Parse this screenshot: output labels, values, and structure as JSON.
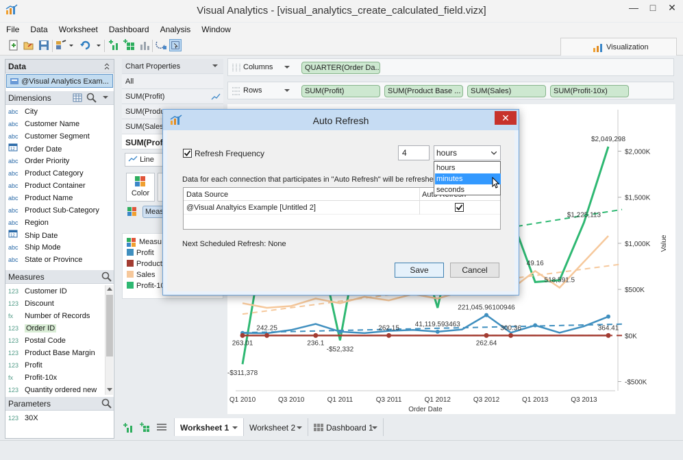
{
  "window": {
    "title": "Visual Analytics - [visual_analytics_create_calculated_field.vizx]",
    "minimize": "—",
    "maximize": "□",
    "close": "✕"
  },
  "menu": [
    "File",
    "Data",
    "Worksheet",
    "Dashboard",
    "Analysis",
    "Window"
  ],
  "toolbar": {
    "icons": [
      "new-icon",
      "open-icon",
      "save-icon",
      "paint-icon",
      "refresh-icon",
      "add-sheet-icon",
      "add-dashboard-icon",
      "bar-chart-icon",
      "lasso-icon",
      "pointer-icon"
    ]
  },
  "visualization_tab": {
    "label": "Visualization"
  },
  "data_panel": {
    "header": "Data",
    "datasource": "@Visual Analytics Exam...",
    "dimensions_label": "Dimensions",
    "dimensions": [
      {
        "type": "abc",
        "name": "City"
      },
      {
        "type": "abc",
        "name": "Customer Name"
      },
      {
        "type": "abc",
        "name": "Customer Segment"
      },
      {
        "type": "date",
        "name": "Order Date"
      },
      {
        "type": "abc",
        "name": "Order Priority"
      },
      {
        "type": "abc",
        "name": "Product Category"
      },
      {
        "type": "abc",
        "name": "Product Container"
      },
      {
        "type": "abc",
        "name": "Product Name"
      },
      {
        "type": "abc",
        "name": "Product Sub-Category"
      },
      {
        "type": "abc",
        "name": "Region"
      },
      {
        "type": "date",
        "name": "Ship Date"
      },
      {
        "type": "abc",
        "name": "Ship Mode"
      },
      {
        "type": "abc",
        "name": "State or Province"
      }
    ],
    "measures_label": "Measures",
    "measures": [
      {
        "type": "123",
        "name": "Customer ID"
      },
      {
        "type": "123",
        "name": "Discount"
      },
      {
        "type": "fx",
        "name": "Number of Records"
      },
      {
        "type": "123",
        "name": "Order ID"
      },
      {
        "type": "123",
        "name": "Postal Code"
      },
      {
        "type": "123",
        "name": "Product Base Margin"
      },
      {
        "type": "123",
        "name": "Profit"
      },
      {
        "type": "fx",
        "name": "Profit-10x"
      },
      {
        "type": "123",
        "name": "Quantity ordered new"
      }
    ],
    "parameters_label": "Parameters",
    "parameters": [
      {
        "type": "123",
        "name": "30X"
      }
    ]
  },
  "chart_properties": {
    "header": "Chart Properties",
    "rows": [
      "All",
      "SUM(Profit)",
      "SUM(Produ",
      "SUM(Sales)",
      "SUM(Profi"
    ],
    "mark_type": "Line",
    "color_label": "Color",
    "measure_pill": "Measu",
    "legend_title": "Measu",
    "legend": [
      {
        "name": "Profit",
        "color": "#3f8fbf"
      },
      {
        "name": "Product",
        "color": "#a33c32"
      },
      {
        "name": "Sales",
        "color": "#f6c89b"
      },
      {
        "name": "Profit-10",
        "color": "#2eb872"
      }
    ]
  },
  "shelves": {
    "columns_label": "Columns",
    "columns": [
      "QUARTER(Order Da..."
    ],
    "rows_label": "Rows",
    "rows": [
      "SUM(Profit)",
      "SUM(Product Base ...",
      "SUM(Sales)",
      "SUM(Profit-10x)"
    ]
  },
  "chart_data": {
    "type": "line",
    "xlabel": "Order Date",
    "ylabel": "Value",
    "categories": [
      "Q1 2010",
      "Q2 2010",
      "Q3 2010",
      "Q4 2010",
      "Q1 2011",
      "Q2 2011",
      "Q3 2011",
      "Q4 2011",
      "Q1 2012",
      "Q2 2012",
      "Q3 2012",
      "Q4 2012",
      "Q1 2013",
      "Q2 2013",
      "Q3 2013",
      "Q4 2013"
    ],
    "x_tick_labels": [
      "Q1 2010",
      "Q3 2010",
      "Q1 2011",
      "Q3 2011",
      "Q1 2012",
      "Q3 2012",
      "Q1 2013",
      "Q3 2013"
    ],
    "y_tick_labels": [
      "$2,000K",
      "$1,500K",
      "$1,000K",
      "$500K",
      "$0K",
      "-$500K"
    ],
    "ylim": [
      -600000,
      2450000
    ],
    "series": [
      {
        "name": "Profit-10x",
        "color": "#2eb872",
        "values": [
          -311378,
          1250000,
          1500000,
          1150000,
          -52332,
          1400000,
          1350000,
          1200000,
          300000,
          1500000,
          1450000,
          1300000,
          580000,
          600000,
          1225113,
          2049298
        ]
      },
      {
        "name": "Sales",
        "color": "#f6c89b",
        "values": [
          350000,
          300000,
          320000,
          400000,
          350000,
          420000,
          380000,
          450000,
          400000,
          480000,
          520000,
          500000,
          700000,
          518591,
          800000,
          1080000
        ]
      },
      {
        "name": "Profit",
        "color": "#3f8fbf",
        "values": [
          26301,
          24225,
          60000,
          125000,
          41120,
          26215,
          50000,
          60000,
          41120,
          65000,
          221046,
          30036,
          110000,
          30000,
          100000,
          204930
        ]
      },
      {
        "name": "Product Base Margin",
        "color": "#a33c32",
        "values": [
          0.5,
          0.5,
          0.5,
          0.5,
          0.5,
          0.5,
          0.5,
          0.5,
          0.5,
          0.5,
          0.5,
          0.5,
          0.5,
          0.5,
          0.5,
          0.5
        ]
      }
    ],
    "annotations": [
      {
        "label": "$2,049,298",
        "series": "Profit-10x",
        "index": 15
      },
      {
        "label": "$1,225,113",
        "series": "Profit-10x",
        "index": 14
      },
      {
        "label": "518,591.5",
        "series": "Sales",
        "index": 13
      },
      {
        "label": "49.16",
        "series": "Sales",
        "index": 12
      },
      {
        "label": "221,045.96100946",
        "series": "Profit",
        "index": 10
      },
      {
        "label": "41,119.593463",
        "series": "Profit",
        "index": 8
      },
      {
        "label": "300.36",
        "series": "Product Base Margin",
        "index": 11
      },
      {
        "label": "263.01",
        "series": "Product Base Margin",
        "index": 0
      },
      {
        "label": "242.25",
        "series": "Product Base Margin",
        "index": 1
      },
      {
        "label": "236.1",
        "series": "Product Base Margin",
        "index": 3
      },
      {
        "label": "262.15",
        "series": "Product Base Margin",
        "index": 6
      },
      {
        "label": "262.64",
        "series": "Product Base Margin",
        "index": 10
      },
      {
        "label": "364.41",
        "series": "Product Base Margin",
        "index": 15
      },
      {
        "label": "-$311,378",
        "series": "Profit-10x",
        "index": 0
      },
      {
        "label": "-$52,332",
        "series": "Profit-10x",
        "index": 4
      }
    ],
    "trend_lines": true,
    "grid": false,
    "legend": "left panel"
  },
  "bottom_tabs": [
    {
      "label": "Worksheet 1",
      "active": true
    },
    {
      "label": "Worksheet 2",
      "active": false
    },
    {
      "label": "Dashboard 1",
      "active": false
    }
  ],
  "dialog": {
    "title": "Auto Refresh",
    "close": "✕",
    "refresh_frequency_label": "Refresh Frequency",
    "refresh_frequency_checked": true,
    "frequency_value": "4",
    "unit_selected": "hours",
    "unit_options": [
      "hours",
      "minutes",
      "seconds"
    ],
    "highlighted_option": "minutes",
    "info_text": "Data for each connection that participates in \"Auto Refresh\" will be refreshed",
    "table_headers": [
      "Data Source",
      "Auto Refresh"
    ],
    "table_rows": [
      {
        "source": "@Visual Analtyics Example [Untitled 2]",
        "checked": true
      }
    ],
    "next_refresh": "Next Scheduled Refresh: None",
    "save_label": "Save",
    "cancel_label": "Cancel"
  }
}
